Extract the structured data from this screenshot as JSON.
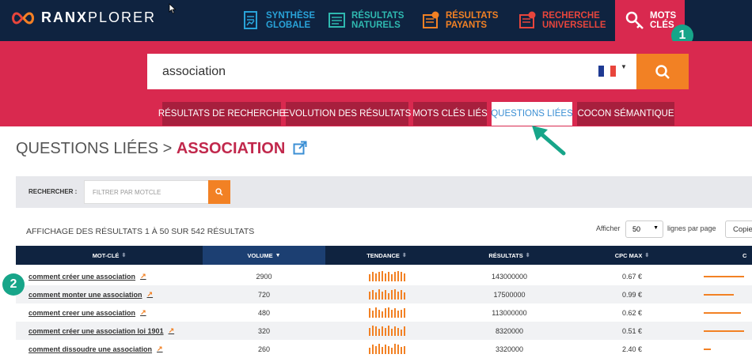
{
  "brand": {
    "name_bold": "RANX",
    "name_light": "PLORER"
  },
  "nav": [
    {
      "id": "synthese",
      "line1": "SYNTHÈSE",
      "line2": "GLOBALE",
      "color": "#29a3d9",
      "icon": "report-icon"
    },
    {
      "id": "naturels",
      "line1": "RÉSULTATS",
      "line2": "NATURELS",
      "color": "#2fb9b0",
      "icon": "list-icon"
    },
    {
      "id": "payants",
      "line1": "RÉSULTATS",
      "line2": "PAYANTS",
      "color": "#f28124",
      "icon": "money-list-icon"
    },
    {
      "id": "universelle",
      "line1": "RECHERCHE",
      "line2": "UNIVERSELLE",
      "color": "#e8453c",
      "icon": "universal-list-icon"
    }
  ],
  "nav_active": {
    "line1": "MOTS",
    "line2": "CLÉS",
    "icon": "key-icon"
  },
  "badges": {
    "one": "1",
    "two": "2"
  },
  "search": {
    "value": "association",
    "flag": "france-flag-icon"
  },
  "tabs": [
    {
      "label": "RÉSULTATS DE RECHERCHE",
      "active": false
    },
    {
      "label": "EVOLUTION DES RÉSULTATS",
      "active": false
    },
    {
      "label": "MOTS CLÉS LIÉS",
      "active": false
    },
    {
      "label": "QUESTIONS LIÉES",
      "active": true
    },
    {
      "label": "COCON SÉMANTIQUE",
      "active": false
    }
  ],
  "page": {
    "title_prefix": "QUESTIONS LIÉES > ",
    "title_keyword": "ASSOCIATION"
  },
  "filter": {
    "label": "RECHERCHER :",
    "placeholder": "FILTRER PAR MOTCLE"
  },
  "results": {
    "showing": "AFFICHAGE DES RÉSULTATS 1 À 50 SUR 542 RÉSULTATS"
  },
  "pagination": {
    "show_label": "Afficher",
    "per_page": "50",
    "per_page_suffix": "lignes par page",
    "copy_label": "Copie"
  },
  "table": {
    "headers": [
      "MOT-CLÉ",
      "VOLUME",
      "TENDANCE",
      "RÉSULTATS",
      "CPC MAX",
      "C"
    ],
    "sorted_column": "VOLUME",
    "rows": [
      {
        "keyword": "comment créer une association",
        "volume": "2900",
        "resultats": "143000000",
        "cpc": "0.67 €",
        "trend": [
          0.7,
          0.9,
          0.8,
          0.9,
          1.0,
          0.8,
          0.9,
          0.7,
          0.9,
          1.0,
          0.9,
          0.8
        ],
        "competition": 0.6
      },
      {
        "keyword": "comment monter une association",
        "volume": "720",
        "resultats": "17500000",
        "cpc": "0.99 €",
        "trend": [
          0.8,
          0.9,
          0.7,
          1.0,
          0.8,
          0.9,
          0.6,
          0.9,
          1.0,
          0.8,
          0.9,
          0.7
        ],
        "competition": 0.45
      },
      {
        "keyword": "comment creer une association",
        "volume": "480",
        "resultats": "113000000",
        "cpc": "0.62 €",
        "trend": [
          0.9,
          0.7,
          1.0,
          0.8,
          0.6,
          0.9,
          1.0,
          0.8,
          0.9,
          0.7,
          0.8,
          0.9
        ],
        "competition": 0.55
      },
      {
        "keyword": "comment créer une association loi 1901",
        "volume": "320",
        "resultats": "8320000",
        "cpc": "0.51 €",
        "trend": [
          0.8,
          1.0,
          0.9,
          0.7,
          0.9,
          0.8,
          1.0,
          0.7,
          0.9,
          0.8,
          0.6,
          0.9
        ],
        "competition": 0.6
      },
      {
        "keyword": "comment dissoudre une association",
        "volume": "260",
        "resultats": "3320000",
        "cpc": "2.40 €",
        "trend": [
          0.6,
          0.9,
          0.8,
          1.0,
          0.7,
          0.9,
          0.8,
          0.6,
          1.0,
          0.9,
          0.7,
          0.8
        ],
        "competition": 0.1
      }
    ]
  }
}
